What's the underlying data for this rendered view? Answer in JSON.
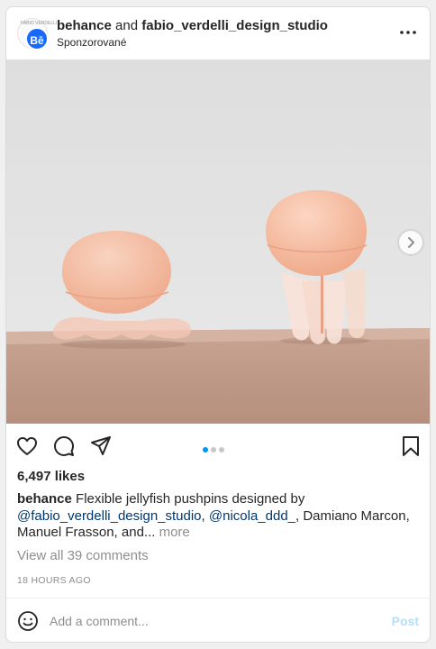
{
  "post": {
    "account_primary": "behance",
    "joiner": "and",
    "account_secondary": "fabio_verdelli_design_studio",
    "sponsored_label": "Sponzorované",
    "avatar_badge_text": "Bē",
    "avatar_small_text": "FABIO VERDELLI",
    "options_icon": "more-horizontal-icon"
  },
  "media": {
    "carousel_dots": 3,
    "active_index": 0,
    "next_icon": "chevron-right-icon"
  },
  "actions": {
    "like_icon": "heart-icon",
    "comment_icon": "comment-icon",
    "share_icon": "send-icon",
    "save_icon": "bookmark-icon"
  },
  "likes": "6,497 likes",
  "caption": {
    "username": "behance",
    "text_1": " Flexible jellyfish pushpins designed by ",
    "mention_1": "@fabio_verdelli_design_studio",
    "sep": ", ",
    "mention_2": "@nicola_ddd_",
    "text_2": ", Damiano Marcon, Manuel Frasson, and... ",
    "more": "more"
  },
  "view_comments": "View all 39 comments",
  "timestamp": "18 HOURS AGO",
  "comment_box": {
    "placeholder": "Add a comment...",
    "post_label": "Post",
    "emoji_icon": "emoji-icon"
  },
  "colors": {
    "accent": "#0095f6",
    "post_disabled": "#b2dffc",
    "behance_blue": "#1769ff",
    "mention": "#00376b"
  }
}
